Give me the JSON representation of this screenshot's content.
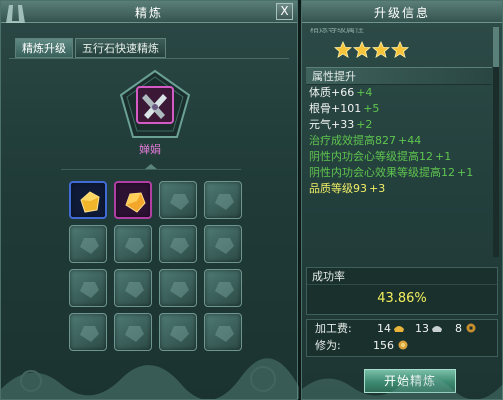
{
  "left": {
    "title": "精炼",
    "close": "X",
    "tabs": [
      {
        "label": "精炼升级",
        "active": true
      },
      {
        "label": "五行石快速精炼",
        "active": false
      }
    ],
    "item_name": "婵娟",
    "grid": {
      "filled": [
        {
          "row": 0,
          "col": 0,
          "kind": "gold-stone",
          "frame": "blue"
        },
        {
          "row": 0,
          "col": 1,
          "kind": "gold-stone",
          "frame": "purple"
        }
      ]
    }
  },
  "right": {
    "title": "升级信息",
    "cut_text": "精炼等级属性",
    "stars": 4,
    "attr_header": "属性提升",
    "attrs": [
      {
        "base": "体质+66",
        "inc": "+4",
        "style": "white"
      },
      {
        "base": "根骨+101",
        "inc": "+5",
        "style": "white"
      },
      {
        "base": "元气+33",
        "inc": "+2",
        "style": "white"
      },
      {
        "base": "治疗成效提高827",
        "inc": "+44",
        "style": "green"
      },
      {
        "base": "阴性内功会心等级提高12",
        "inc": "+1",
        "style": "green"
      },
      {
        "base": "阴性内功会心效果等级提高12",
        "inc": "+1",
        "style": "green"
      },
      {
        "base": "品质等级93",
        "inc": "+3",
        "style": "yellow"
      }
    ],
    "success_label": "成功率",
    "success_value": "43.86%",
    "cost_label": "加工费:",
    "cost_gold": "14",
    "cost_silver": "13",
    "cost_copper": "8",
    "cultivation_label": "修为:",
    "cultivation_value": "156",
    "start_button": "开始精炼"
  },
  "colors": {
    "green_text": "#5fc54e",
    "yellow_text": "#f1ef66",
    "item_name": "#e07ad6"
  }
}
